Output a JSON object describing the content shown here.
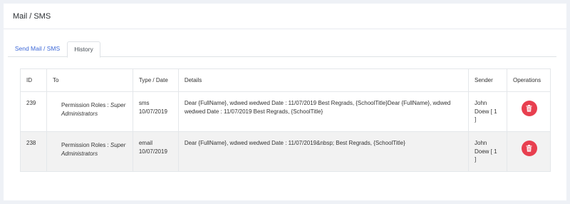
{
  "page": {
    "title": "Mail / SMS"
  },
  "tabs": [
    {
      "label": "Send Mail / SMS"
    },
    {
      "label": "History"
    }
  ],
  "table": {
    "headers": {
      "id": "ID",
      "to": "To",
      "type_date": "Type / Date",
      "details": "Details",
      "sender": "Sender",
      "operations": "Operations"
    },
    "rows": [
      {
        "id": "239",
        "to_prefix": "Permission Roles : ",
        "to_role": "Super Administrators",
        "type": "sms",
        "date": "10/07/2019",
        "details": "Dear {FullName}, wdwed wedwed Date : 11/07/2019  Best Regrads, {SchoolTitle}Dear {FullName}, wdwed wedwed Date : 11/07/2019  Best Regrads, {SchoolTitle}",
        "sender": "John Doew [ 1 ]"
      },
      {
        "id": "238",
        "to_prefix": "Permission Roles : ",
        "to_role": "Super Administrators",
        "type": "email",
        "date": "10/07/2019",
        "details": "Dear {FullName}, wdwed wedwed Date : 11/07/2019&nbsp; Best Regrads, {SchoolTitle}",
        "sender": "John Doew [ 1 ]"
      }
    ]
  },
  "colors": {
    "accent": "#3f6ad8",
    "danger": "#e83f4f",
    "background": "#eef1f6"
  },
  "icons": {
    "delete": "trash-icon"
  }
}
